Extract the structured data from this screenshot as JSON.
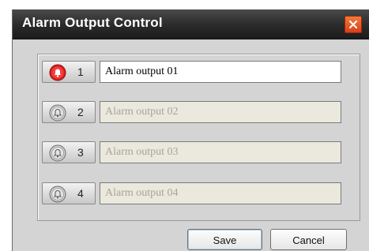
{
  "dialog": {
    "title": "Alarm Output Control"
  },
  "outputs": [
    {
      "number": "1",
      "name": "Alarm output 01",
      "active": true
    },
    {
      "number": "2",
      "name": "Alarm output 02",
      "active": false
    },
    {
      "number": "3",
      "name": "Alarm output 03",
      "active": false
    },
    {
      "number": "4",
      "name": "Alarm output 04",
      "active": false
    }
  ],
  "buttons": {
    "save_label": "Save",
    "cancel_label": "Cancel"
  },
  "icons": {
    "close": "close-icon",
    "alarm_on": "alarm-bell-red-icon",
    "alarm_off": "alarm-bell-gray-icon"
  },
  "colors": {
    "titlebar": "#2a2a2a",
    "close_button": "#e05520",
    "alarm_active": "#e02020",
    "field_inactive": "#ebe8dd"
  }
}
